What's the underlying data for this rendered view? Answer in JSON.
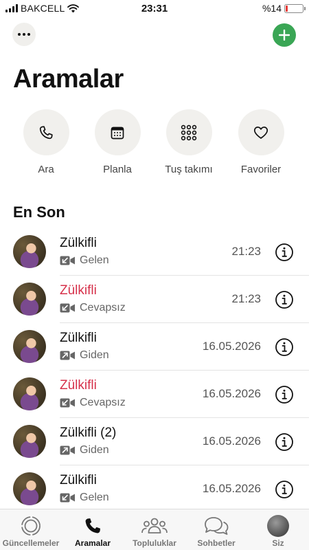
{
  "status_bar": {
    "carrier": "BAKCELL",
    "time": "23:31",
    "battery_text": "%14",
    "battery_level": 0.14
  },
  "header": {
    "title": "Aramalar"
  },
  "quick_actions": [
    {
      "label": "Ara",
      "icon": "phone-icon"
    },
    {
      "label": "Planla",
      "icon": "calendar-icon"
    },
    {
      "label": "Tuş takımı",
      "icon": "keypad-icon"
    },
    {
      "label": "Favoriler",
      "icon": "heart-icon"
    }
  ],
  "recent": {
    "title": "En Son",
    "calls": [
      {
        "name": "Zülkifli",
        "missed": false,
        "direction": "incoming",
        "status": "Gelen",
        "time": "21:23"
      },
      {
        "name": "Zülkifli",
        "missed": true,
        "direction": "incoming",
        "status": "Cevapsız",
        "time": "21:23"
      },
      {
        "name": "Zülkifli",
        "missed": false,
        "direction": "outgoing",
        "status": "Giden",
        "time": "16.05.2026"
      },
      {
        "name": "Zülkifli",
        "missed": true,
        "direction": "incoming",
        "status": "Cevapsız",
        "time": "16.05.2026"
      },
      {
        "name": "Zülkifli  (2)",
        "missed": false,
        "direction": "outgoing",
        "status": "Giden",
        "time": "16.05.2026"
      },
      {
        "name": "Zülkifli",
        "missed": false,
        "direction": "incoming",
        "status": "Gelen",
        "time": "16.05.2026"
      }
    ]
  },
  "tabs": [
    {
      "label": "Güncellemeler",
      "icon": "updates-icon",
      "active": false
    },
    {
      "label": "Aramalar",
      "icon": "phone-icon",
      "active": true
    },
    {
      "label": "Topluluklar",
      "icon": "communities-icon",
      "active": false
    },
    {
      "label": "Sohbetler",
      "icon": "chats-icon",
      "active": false
    },
    {
      "label": "Siz",
      "icon": "profile-avatar",
      "active": false
    }
  ],
  "colors": {
    "accent_green": "#3aa655",
    "missed_red": "#d6304a",
    "battery_low": "#e53935"
  }
}
